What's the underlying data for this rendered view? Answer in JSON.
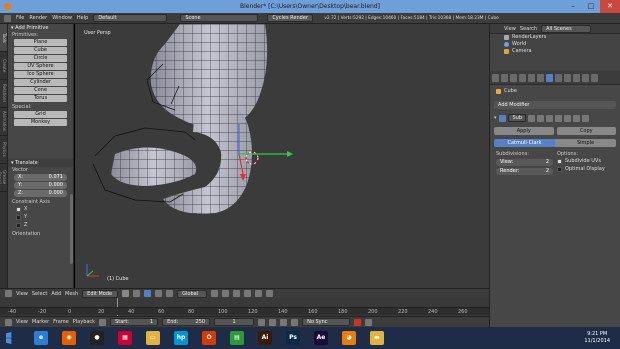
{
  "window": {
    "title": "Blender* [C:\\Users\\Owner\\Desktop\\bear.blend]",
    "min": "–",
    "max": "□",
    "close": "✕"
  },
  "topbar": {
    "menus": [
      "File",
      "Render",
      "Window",
      "Help"
    ],
    "layout": "Default",
    "scene": "Scene",
    "engine": "Cycles Render",
    "stats": "v2.72 | Verts:5292 | Edges:10460 | Faces:5184 | Tris:10368 | Mem:18.23M | Cube"
  },
  "toolshelf": {
    "tabs": [
      "Tools",
      "Create",
      "Relations",
      "Animation",
      "Physics",
      "Grease Pencil"
    ],
    "panel": "Add Primitive",
    "mesh_label": "Primitives:",
    "mesh": [
      "Plane",
      "Cube",
      "Circle",
      "UV Sphere",
      "Ico Sphere",
      "Cylinder",
      "Cone",
      "Torus"
    ],
    "special_label": "Special:",
    "special": [
      "Grid",
      "Monkey"
    ],
    "translate": {
      "title": "Translate",
      "vector_label": "Vector",
      "x_label": "X:",
      "x": "0.071",
      "y_label": "Y:",
      "y": "0.000",
      "z_label": "Z:",
      "z": "0.000",
      "constraint_label": "Constraint Axis",
      "axes": [
        "X",
        "Y",
        "Z"
      ],
      "orientation_label": "Orientation"
    }
  },
  "viewport": {
    "label": "User Persp",
    "object": "(1) Cube"
  },
  "viewheader": {
    "menus": [
      "View",
      "Select",
      "Add",
      "Mesh"
    ],
    "mode": "Edit Mode",
    "pivot": "Global"
  },
  "timeline": {
    "ticks": [
      "-40",
      "-20",
      "0",
      "20",
      "40",
      "60",
      "80",
      "100",
      "120",
      "140",
      "160",
      "180",
      "200",
      "220",
      "240",
      "260"
    ],
    "menus": [
      "View",
      "Marker",
      "Frame",
      "Playback"
    ],
    "start_label": "Start:",
    "start": "1",
    "end_label": "End:",
    "end": "250",
    "current": "1",
    "sync": "No Sync"
  },
  "outliner": {
    "header_items": [
      "View",
      "Search",
      "All Scenes"
    ],
    "items": [
      "RenderLayers",
      "World",
      "Camera"
    ]
  },
  "properties": {
    "object": "Cube",
    "add_modifier": "Add Modifier",
    "modifier_name": "Sub",
    "apply": "Apply",
    "copy": "Copy",
    "catmull": "Catmull-Clark",
    "simple": "Simple",
    "subdivisions_label": "Subdivisions:",
    "view_label": "View:",
    "view": "2",
    "render_label": "Render:",
    "render": "2",
    "options_label": "Options:",
    "subdivide_uvs": "Subdivide UVs",
    "optimal_display": "Optimal Display"
  },
  "taskbar": {
    "apps": [
      {
        "name": "ie-icon",
        "color": "#2a7fd4",
        "glyph": "e"
      },
      {
        "name": "firefox-icon",
        "color": "#e66000",
        "glyph": "◉"
      },
      {
        "name": "media-icon",
        "color": "#222222",
        "glyph": "●"
      },
      {
        "name": "tiles-icon",
        "color": "#c03",
        "glyph": "▦"
      },
      {
        "name": "explorer-icon",
        "color": "#e3b341",
        "glyph": "▭"
      },
      {
        "name": "hp-icon",
        "color": "#0096d6",
        "glyph": "hp"
      },
      {
        "name": "office-icon",
        "color": "#d83b01",
        "glyph": "O"
      },
      {
        "name": "store-icon",
        "color": "#2d9a3a",
        "glyph": "▤"
      },
      {
        "name": "illustrator-icon",
        "color": "#3a1a06",
        "glyph": "Ai"
      },
      {
        "name": "photoshop-icon",
        "color": "#0a2a4a",
        "glyph": "Ps"
      },
      {
        "name": "aftereffects-icon",
        "color": "#1a0a3a",
        "glyph": "Ae"
      },
      {
        "name": "blender-icon",
        "color": "#e87d0d",
        "glyph": "◕"
      },
      {
        "name": "folder-icon",
        "color": "#e3b341",
        "glyph": "▬"
      }
    ],
    "time": "9:21 PM",
    "date": "11/1/2014"
  },
  "colors": {
    "accent": "#5680c2",
    "header": "#3c3c3c",
    "panel": "#474747",
    "taskbar": "#1e2c47"
  }
}
